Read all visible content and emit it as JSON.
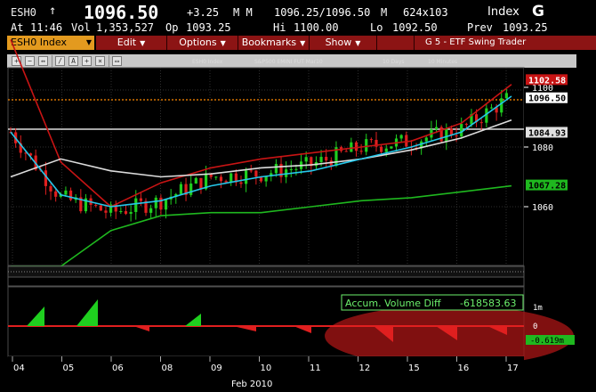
{
  "quote": {
    "ticker": "ESH0",
    "arrow": "↑",
    "last": "1096.50",
    "change": "+3.25",
    "mm": "M M",
    "bid_ask": "1096.25/1096.50",
    "m2": "M",
    "size": "624x103",
    "index_label": "Index",
    "g_label": "G"
  },
  "stats": {
    "at_label": "At",
    "time": "11:46",
    "vol_label": "Vol",
    "volume": "1,353,527",
    "op_label": "Op",
    "open": "1093.25",
    "hi_label": "Hi",
    "high": "1100.00",
    "lo_label": "Lo",
    "low": "1092.50",
    "prev_label": "Prev",
    "prev": "1093.25"
  },
  "menu": {
    "security": "ESH0 Index",
    "edit": "Edit",
    "options": "Options",
    "bookmarks": "Bookmarks",
    "show": "Show",
    "title": "G 5 - ETF Swing Trader"
  },
  "icons": [
    "toolbar-icon",
    "toolbar-icon",
    "toolbar-icon",
    "toolbar-icon",
    "toolbar-icon",
    "toolbar-icon",
    "toolbar-icon",
    "toolbar-icon"
  ],
  "chart_header": {
    "security": "ESH0 Index",
    "name": "S&P500 EMINI FUT Mar10",
    "period": "10 Days",
    "interval": "10 Minutes"
  },
  "price_axis": {
    "ticks": [
      "1100",
      "1080",
      "1060"
    ],
    "badges": [
      {
        "label": "1102.58",
        "color": "#c81414",
        "text_color": "#ffffff"
      },
      {
        "label": "1096.50",
        "color": "#ffffff",
        "text_color": "#000000"
      },
      {
        "label": "1084.93",
        "color": "#e0e0e0",
        "text_color": "#000000"
      },
      {
        "label": "1067.28",
        "color": "#1fb81f",
        "text_color": "#000000"
      }
    ]
  },
  "volume_panel": {
    "legend_label": "Accum. Volume Diff",
    "legend_value": "-618583.63",
    "ticks": [
      "1m",
      "0"
    ],
    "badge": "-0.619m"
  },
  "x_axis": {
    "days": [
      "04",
      "05",
      "06",
      "08",
      "09",
      "10",
      "11",
      "12",
      "15",
      "16",
      "17"
    ],
    "month": "Feb 2010"
  },
  "colors": {
    "up": "#1fcf1f",
    "down": "#e01f1f",
    "ma_red": "#c81414",
    "ma_white": "#dcdcdc",
    "ma_cyan": "#25c7ea",
    "ma_green": "#1fb81f",
    "dotted_orange": "#ff8a00",
    "accent_menu": "#8c1414",
    "security_box": "#e39a1f",
    "legend_box": "#6cf06c"
  },
  "chart_data": {
    "type": "line",
    "title": "S&P500 EMINI FUT Mar10",
    "x": [
      "04",
      "05",
      "06",
      "08",
      "09",
      "10",
      "11",
      "12",
      "15",
      "16",
      "17"
    ],
    "series": [
      {
        "values": [
          1085,
          1063,
          1058,
          1062,
          1070,
          1071,
          1074,
          1080,
          1082,
          1086,
          1097
        ]
      },
      {
        "values": [
          1116,
          1075,
          1060,
          1068,
          1073,
          1076,
          1078,
          1080,
          1082,
          1088,
          1101
        ]
      },
      {
        "values": [
          1070,
          1076,
          1072,
          1070,
          1071,
          1073,
          1074,
          1076,
          1079,
          1083,
          1089
        ]
      },
      {
        "values": [
          1085,
          1064,
          1060,
          1062,
          1067,
          1070,
          1072,
          1076,
          1080,
          1085,
          1097
        ]
      },
      {
        "values": [
          1040,
          1040,
          1052,
          1057,
          1058,
          1058,
          1060,
          1062,
          1063,
          1065,
          1067
        ]
      }
    ],
    "ylim": [
      1040,
      1104
    ],
    "ylabel": "",
    "xlabel": "Feb 2010"
  }
}
